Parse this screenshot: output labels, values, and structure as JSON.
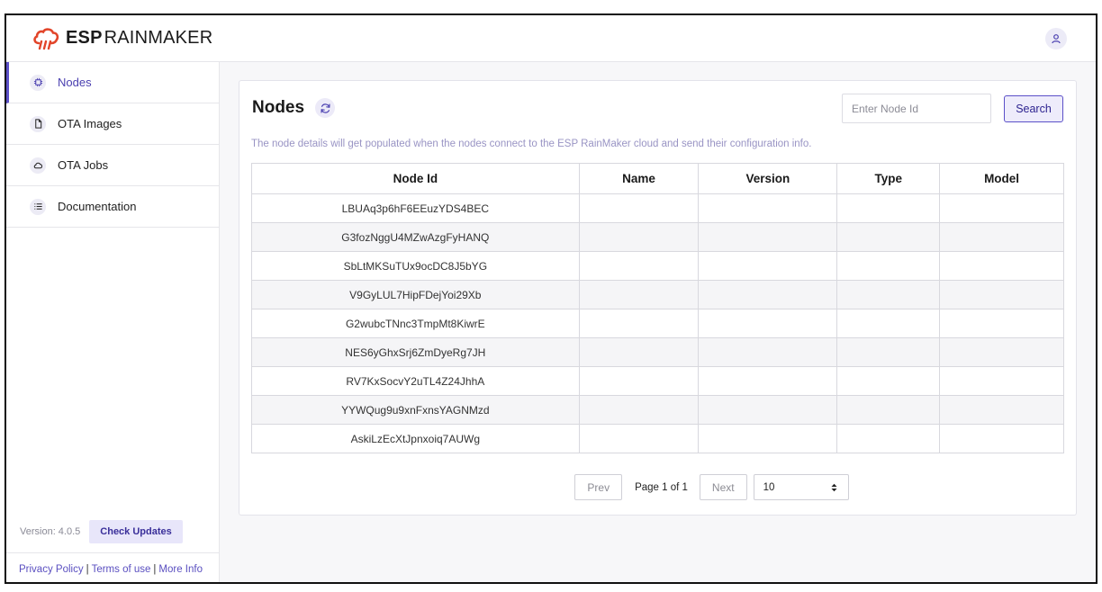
{
  "brand": {
    "bold": "ESP",
    "light": "RAINMAKER",
    "accent": "#e2452a"
  },
  "colors": {
    "primary": "#5b50c8",
    "primary_light": "#eeecfb",
    "link": "#5a4fc0"
  },
  "sidebar": {
    "items": [
      {
        "label": "Nodes",
        "icon": "chip-icon",
        "active": true
      },
      {
        "label": "OTA Images",
        "icon": "file-icon",
        "active": false
      },
      {
        "label": "OTA Jobs",
        "icon": "cloud-icon",
        "active": false
      },
      {
        "label": "Documentation",
        "icon": "list-icon",
        "active": false
      }
    ],
    "version_text": "Version: 4.0.5",
    "check_updates": "Check Updates",
    "footer": {
      "privacy": "Privacy Policy",
      "sep": "|",
      "terms": "Terms of use",
      "more": "More Info"
    }
  },
  "main": {
    "title": "Nodes",
    "search": {
      "placeholder": "Enter Node Id",
      "value": "",
      "button": "Search"
    },
    "info": "The node details will get populated when the nodes connect to the ESP RainMaker cloud and send their configuration info.",
    "table": {
      "headers": [
        "Node Id",
        "Name",
        "Version",
        "Type",
        "Model"
      ],
      "rows": [
        [
          "LBUAq3p6hF6EEuzYDS4BEC",
          "",
          "",
          "",
          ""
        ],
        [
          "G3fozNggU4MZwAzgFyHANQ",
          "",
          "",
          "",
          ""
        ],
        [
          "SbLtMKSuTUx9ocDC8J5bYG",
          "",
          "",
          "",
          ""
        ],
        [
          "V9GyLUL7HipFDejYoi29Xb",
          "",
          "",
          "",
          ""
        ],
        [
          "G2wubcTNnc3TmpMt8KiwrE",
          "",
          "",
          "",
          ""
        ],
        [
          "NES6yGhxSrj6ZmDyeRg7JH",
          "",
          "",
          "",
          ""
        ],
        [
          "RV7KxSocvY2uTL4Z24JhhA",
          "",
          "",
          "",
          ""
        ],
        [
          "YYWQug9u9xnFxnsYAGNMzd",
          "",
          "",
          "",
          ""
        ],
        [
          "AskiLzEcXtJpnxoiq7AUWg",
          "",
          "",
          "",
          ""
        ]
      ]
    },
    "pagination": {
      "prev": "Prev",
      "page_label": "Page 1 of 1",
      "next": "Next",
      "page_size": "10"
    }
  }
}
